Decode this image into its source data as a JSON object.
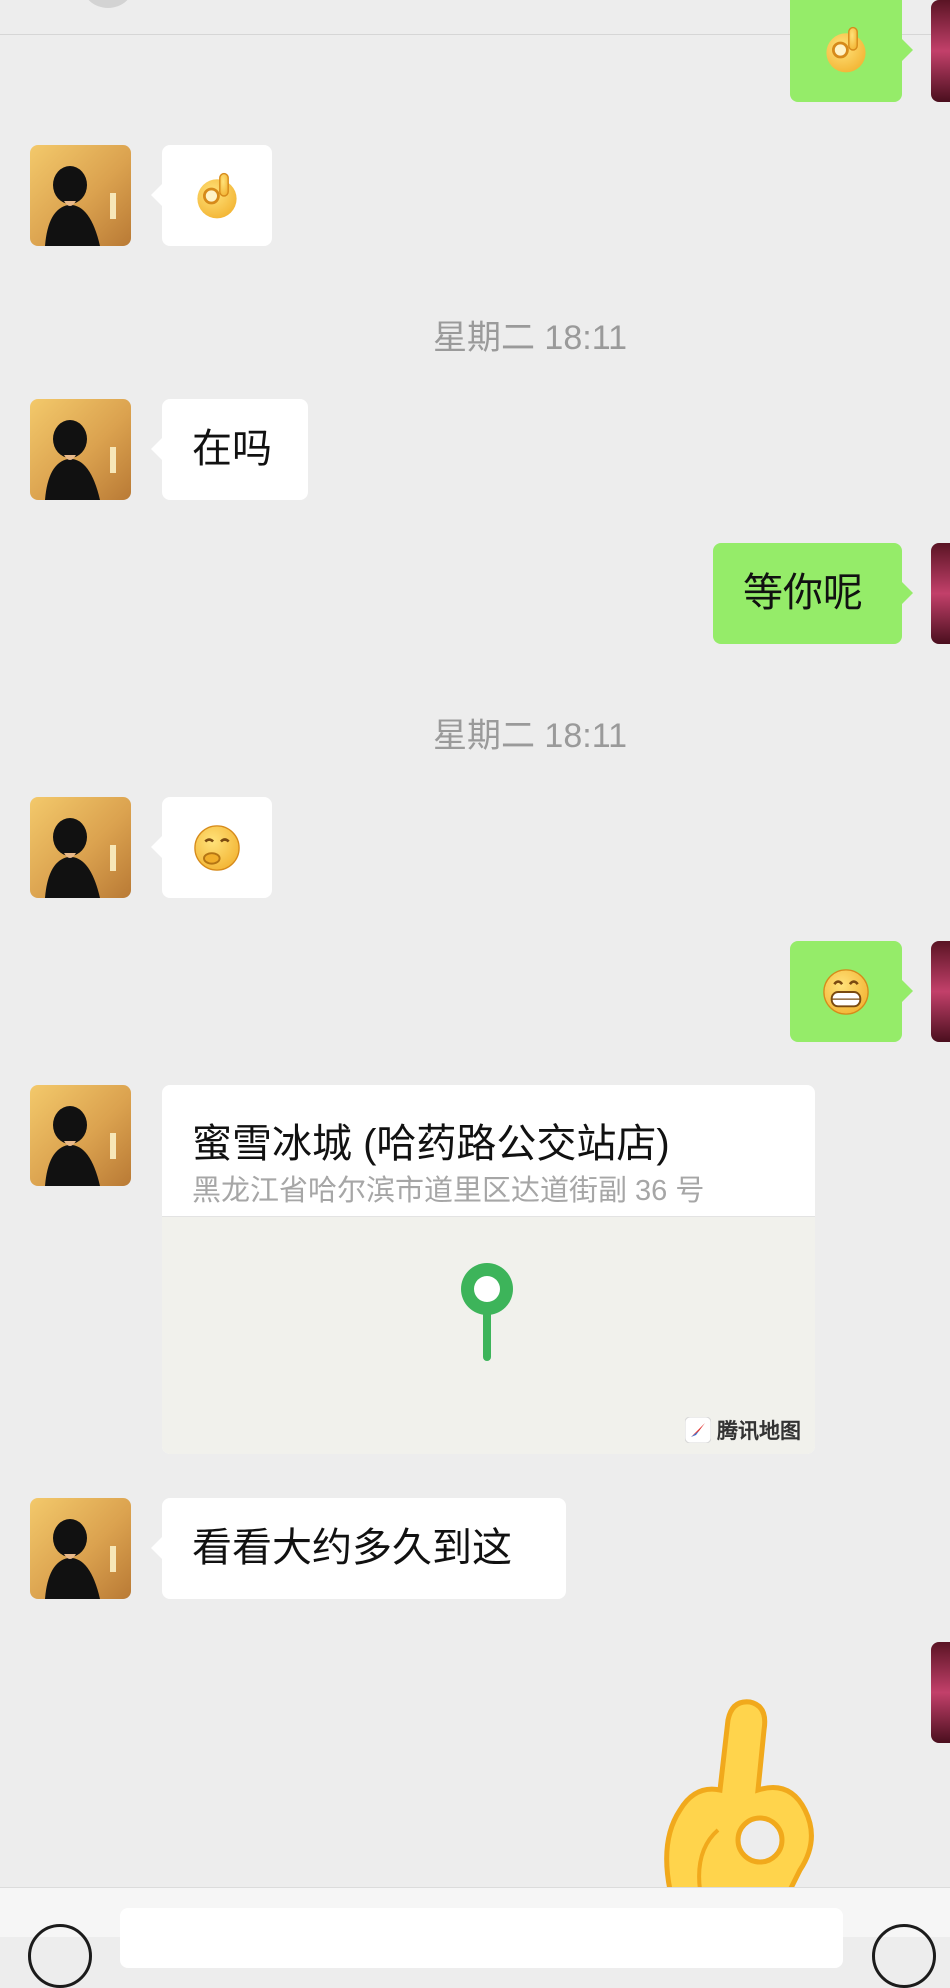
{
  "messages": {
    "m1": {
      "text": "在吗"
    },
    "m2": {
      "text": "等你呢"
    },
    "m3": {
      "text": "看看大约多久到这"
    }
  },
  "timestamps": [
    "星期二 18:11",
    "星期二 18:11"
  ],
  "location": {
    "name": "蜜雪冰城 (哈药路公交站店)",
    "address": "黑龙江省哈尔滨市道里区达道街副 36 号",
    "map_provider": "腾讯地图"
  },
  "icons": {
    "ok_hand": "ok-hand-emoji",
    "thinking": "thinking-face-emoji",
    "grin": "grinning-face-emoji",
    "pin": "location-pin-icon"
  },
  "colors": {
    "background": "#ededed",
    "bubble_in": "#ffffff",
    "bubble_out": "#95ec69",
    "timestamp": "#9a9a9a",
    "pin": "#3db45a"
  }
}
